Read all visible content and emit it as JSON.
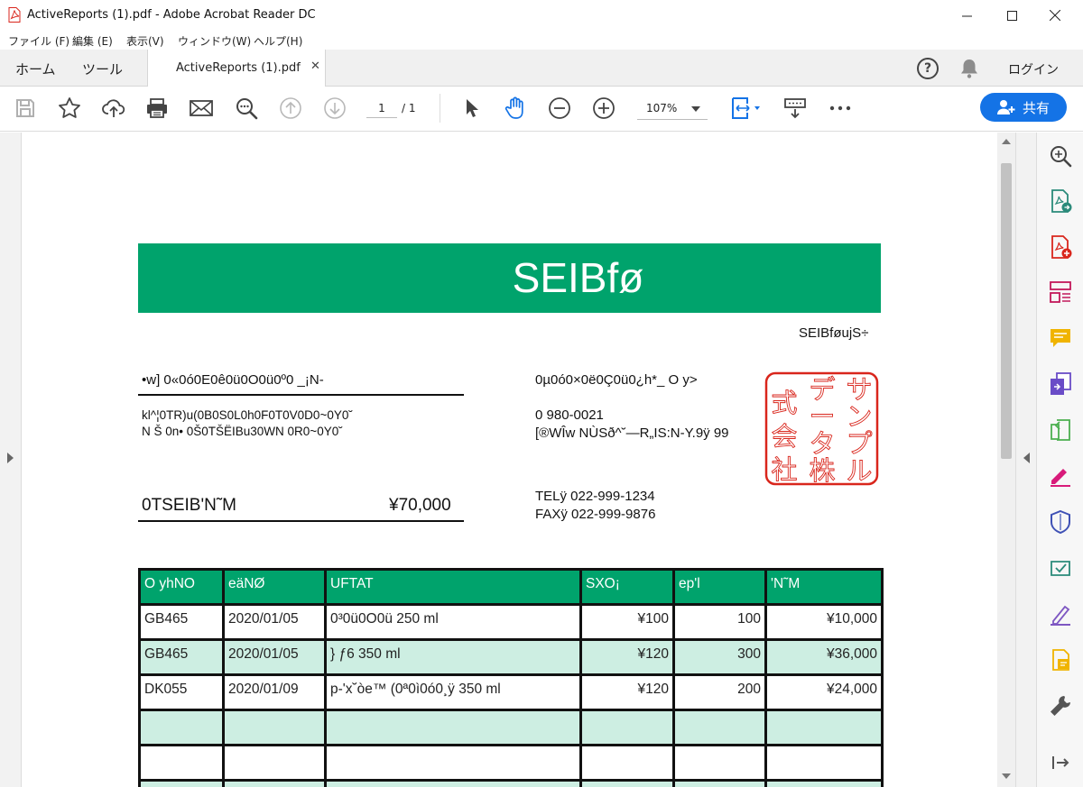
{
  "window": {
    "title": "ActiveReports (1).pdf - Adobe Acrobat Reader DC"
  },
  "menu": [
    {
      "label": "ファイル (F)"
    },
    {
      "label": "編集 (E)"
    },
    {
      "label": "表示(V)"
    },
    {
      "label": "ウィンドウ(W)"
    },
    {
      "label": "ヘルプ(H)"
    }
  ],
  "tabs": {
    "home": "ホーム",
    "tools": "ツール",
    "document": "ActiveReports (1).pdf",
    "close_glyph": "✕"
  },
  "header_right": {
    "help_glyph": "?",
    "login": "ログイン"
  },
  "toolbar": {
    "current_page": "1",
    "page_separator": "/ 1",
    "zoom": "107%",
    "share": "共有"
  },
  "document": {
    "banner_title": "SEIBfø",
    "subtitle": "SEIBføujS÷",
    "customer_name": "•w] 0«0ó0E0ê0ü0O0ü0º0 _¡N-",
    "customer_line1": "kl^¦0TR)u(0B0S0L0h0F0T0V0D0~0Y0˘",
    "customer_line2": "N Š 0n• 0Š0TŠËIBu30WN 0R0~0Y0˘",
    "total_label": "0TSEIB'N˜M",
    "total_value": "¥70,000",
    "issuer_name": "0µ0ó0×0ë0Ç0ü0¿h*_ O y>",
    "issuer_postal": "0 980-0021",
    "issuer_address": "[®WÎw NÙSð^˘—R„IS:N-Y.9ÿ 99",
    "issuer_tel": "TELÿ 022-999-1234",
    "issuer_fax": "FAXÿ 022-999-9876",
    "seal_chars": [
      "サ",
      "ン",
      "プ",
      "ル",
      "デ",
      "ー",
      "タ",
      "株",
      "式",
      "会",
      "社"
    ],
    "seal_color": "#d9261c",
    "accent_color": "#00a36c",
    "table_headers": [
      "O yhNO",
      "eäNØ",
      "UFTAT",
      "SXO¡",
      "ep'l",
      "'N˜M"
    ],
    "rows": [
      [
        "GB465",
        "2020/01/05",
        "0³0ü0O0ü 250 ml",
        "¥100",
        "100",
        "¥10,000"
      ],
      [
        "GB465",
        "2020/01/05",
        "} ƒ6 350 ml",
        "¥120",
        "300",
        "¥36,000"
      ],
      [
        "DK055",
        "2020/01/09",
        "p-'x˘òe™ (0ª0ì0ó0¸ÿ  350 ml",
        "¥120",
        "200",
        "¥24,000"
      ],
      [
        "",
        "",
        "",
        "",
        "",
        ""
      ],
      [
        "",
        "",
        "",
        "",
        "",
        ""
      ],
      [
        "",
        "",
        "",
        "",
        "",
        ""
      ]
    ]
  }
}
